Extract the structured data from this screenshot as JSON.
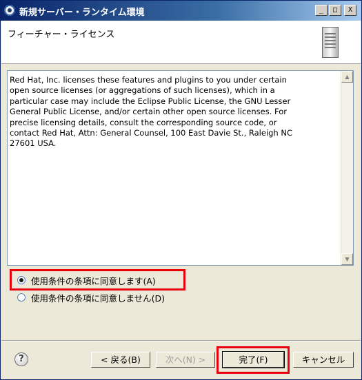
{
  "window": {
    "title": "新規サーバー・ランタイム環境",
    "minimize_glyph": "_",
    "maximize_glyph": "□",
    "close_glyph": "X"
  },
  "banner": {
    "title": "フィーチャー・ライセンス",
    "icon": "server-icon"
  },
  "license": {
    "text": "Red Hat, Inc. licenses these features and plugins to you under certain\nopen source licenses (or aggregations of such licenses), which in a\nparticular case may include the Eclipse Public License, the GNU Lesser\nGeneral Public License, and/or certain other open source licenses. For\nprecise licensing details, consult the corresponding source code, or\ncontact Red Hat, Attn: General Counsel, 100 East Davie St., Raleigh NC\n27601 USA."
  },
  "radios": {
    "accept_label": "使用条件の条項に同意します(A)",
    "decline_label": "使用条件の条項に同意しません(D)",
    "selected": "accept"
  },
  "footer": {
    "help_glyph": "?",
    "back_label": "< 戻る(B)",
    "next_label": "次へ(N) >",
    "finish_label": "完了(F)",
    "cancel_label": "キャンセル"
  },
  "highlight_color": "#e8000f"
}
